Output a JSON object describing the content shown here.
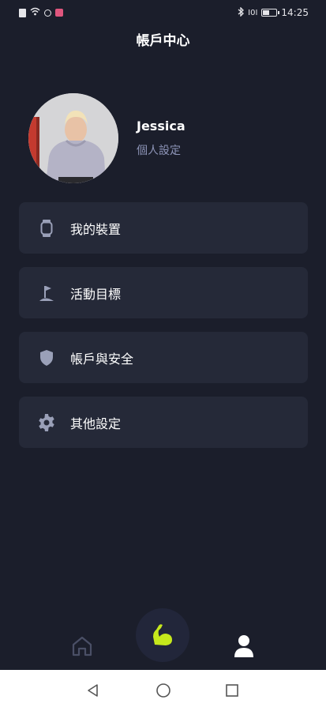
{
  "status_bar": {
    "time": "14:25",
    "signal": "I0I"
  },
  "header": {
    "title": "帳戶中心"
  },
  "profile": {
    "name": "Jessica",
    "settings_link": "個人設定"
  },
  "menu": {
    "items": [
      {
        "label": "我的裝置",
        "icon": "watch-icon"
      },
      {
        "label": "活動目標",
        "icon": "flag-icon"
      },
      {
        "label": "帳戶與安全",
        "icon": "shield-icon"
      },
      {
        "label": "其他設定",
        "icon": "gear-icon"
      }
    ]
  },
  "tab_bar": {
    "items": [
      {
        "name": "home",
        "icon": "home-icon",
        "active": false
      },
      {
        "name": "workout",
        "icon": "flexed-arm-icon",
        "active": false
      },
      {
        "name": "account",
        "icon": "person-icon",
        "active": true
      }
    ]
  },
  "colors": {
    "background": "#1b1e2b",
    "card": "#252938",
    "accent": "#c6e81c",
    "muted_text": "#8e95b8"
  }
}
